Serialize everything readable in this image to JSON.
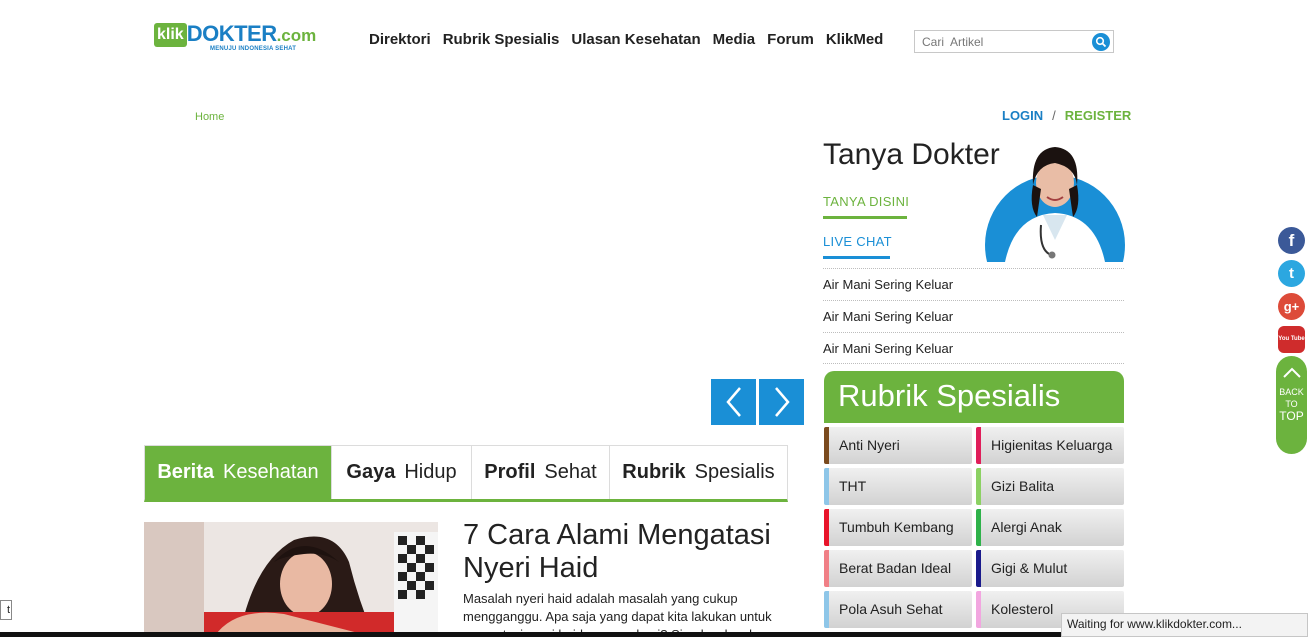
{
  "header": {
    "logo": {
      "klik": "klik",
      "dokter": "DOKTER",
      "com": ".com",
      "tagline": "MENUJU INDONESIA SEHAT"
    },
    "nav": [
      "Direktori",
      "Rubrik Spesialis",
      "Ulasan Kesehatan",
      "Media",
      "Forum",
      "KlikMed"
    ],
    "search": {
      "placeholder": "Cari  Artikel"
    }
  },
  "breadcrumb": "Home",
  "auth": {
    "login": "LOGIN",
    "separator": "/",
    "register": "REGISTER"
  },
  "tabs": [
    {
      "bold": "Berita",
      "rest": "Kesehatan",
      "active": true
    },
    {
      "bold": "Gaya",
      "rest": "Hidup",
      "active": false
    },
    {
      "bold": "Profil",
      "rest": "Sehat",
      "active": false
    },
    {
      "bold": "Rubrik",
      "rest": "Spesialis",
      "active": false
    }
  ],
  "article": {
    "title": "7 Cara Alami Mengatasi Nyeri Haid",
    "excerpt": "Masalah nyeri haid adalah masalah yang cukup mengganggu. Apa saja yang dapat kita lakukan untuk mengatasi nyeri haid secara alami? Simak selengkapnya"
  },
  "tanya": {
    "title": "Tanya Dokter",
    "ask_link": "TANYA  DISINI",
    "chat_link": "LIVE  CHAT",
    "questions": [
      "Air Mani Sering Keluar",
      "Air Mani Sering Keluar",
      "Air Mani Sering Keluar"
    ]
  },
  "rubrik": {
    "title": "Rubrik Spesialis",
    "items": [
      {
        "label": "Anti Nyeri",
        "color": "#7a4a1e"
      },
      {
        "label": "Higienitas Keluarga",
        "color": "#e01e5a"
      },
      {
        "label": "THT",
        "color": "#8ec6e8"
      },
      {
        "label": "Gizi Balita",
        "color": "#8cd163"
      },
      {
        "label": "Tumbuh Kembang",
        "color": "#e8142a"
      },
      {
        "label": "Alergi Anak",
        "color": "#2fb24a"
      },
      {
        "label": "Berat Badan Ideal",
        "color": "#f07f86"
      },
      {
        "label": "Gigi & Mulut",
        "color": "#1a1a8c"
      },
      {
        "label": "Pola Asuh Sehat",
        "color": "#8ec6e8"
      },
      {
        "label": "Kolesterol",
        "color": "#f2a6e0"
      }
    ]
  },
  "social": [
    {
      "icon": "facebook-icon",
      "glyph": "f",
      "color": "#3b5998"
    },
    {
      "icon": "twitter-icon",
      "glyph": "t",
      "color": "#2ca7e0"
    },
    {
      "icon": "google-plus-icon",
      "glyph": "g+",
      "color": "#dd4b39"
    },
    {
      "icon": "youtube-icon",
      "glyph": "You Tube",
      "color": "#cf2c2c"
    }
  ],
  "backtop": {
    "line1": "BACK",
    "line2": "TO",
    "line3": "TOP"
  },
  "status_bar": "Waiting for www.klikdokter.com...",
  "corner_char": "t"
}
